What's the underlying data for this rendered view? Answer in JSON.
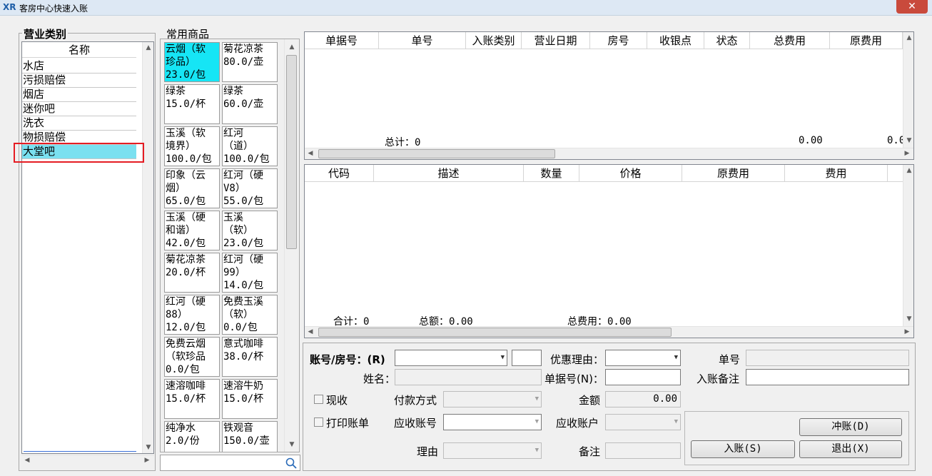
{
  "window": {
    "title": "客房中心快速入账",
    "app_icon": "XR",
    "close_glyph": "✕"
  },
  "category_panel": {
    "title": "营业类别",
    "column_header": "名称",
    "items": [
      "水店",
      "污损赔偿",
      "烟店",
      "迷你吧",
      "洗衣",
      "物损赔偿",
      "大堂吧"
    ],
    "selected_index": 6
  },
  "products_panel": {
    "title": "常用商品",
    "tiles": [
      "云烟（软\n珍品）\n23.0/包",
      "菊花凉茶\n80.0/壶",
      "绿茶\n15.0/杯",
      "绿茶\n60.0/壶",
      "玉溪（软\n境界）\n100.0/包",
      "红河\n（道）\n100.0/包",
      "印象（云\n烟）\n65.0/包",
      "红河（硬\nV8）\n55.0/包",
      "玉溪（硬\n和谐）\n42.0/包",
      "玉溪\n（软）\n23.0/包",
      "菊花凉茶\n20.0/杯",
      "红河（硬\n99）\n14.0/包",
      "红河（硬\n88）\n12.0/包",
      "免费玉溪\n（软）\n0.0/包",
      "免费云烟\n（软珍品\n0.0/包",
      "意式咖啡\n38.0/杯",
      "速溶咖啡\n15.0/杯",
      "速溶牛奶\n15.0/杯",
      "纯净水\n2.0/份",
      "铁观音\n150.0/壶"
    ],
    "active_index": 0,
    "search_placeholder": ""
  },
  "bill_grid": {
    "columns": [
      "单据号",
      "单号",
      "入账类别",
      "营业日期",
      "房号",
      "收银点",
      "状态",
      "总费用",
      "原费用"
    ],
    "rows": [],
    "total_label": "总计：0",
    "total_fee": "0.00",
    "total_orig_fee": "0.0"
  },
  "detail_grid": {
    "columns": [
      "代码",
      "描述",
      "数量",
      "价格",
      "原费用",
      "费用"
    ],
    "rows": [],
    "summary_count": "合计：0",
    "summary_amount": "总额：0.00",
    "summary_fee": "总费用：0.00"
  },
  "form": {
    "account_label": "账号/房号：(R)",
    "account_value": "",
    "account_extra": "",
    "discount_label": "优惠理由：",
    "discount_value": "",
    "order_no_label": "单号",
    "order_no_value": "",
    "name_label": "姓名：",
    "name_value": "",
    "doc_no_label": "单据号(N)：",
    "doc_no_value": "",
    "remark_label": "入账备注",
    "remark_value": "",
    "cash_label": "现收",
    "cash_checked": false,
    "payment_label": "付款方式",
    "payment_value": "",
    "amount_label": "金额",
    "amount_value": "0.00",
    "print_label": "打印账单",
    "print_checked": false,
    "receivable_account_label": "应收账号",
    "receivable_account_value": "",
    "receivable_owner_label": "应收账户",
    "receivable_owner_value": "",
    "reason_label": "理由",
    "reason_value": "",
    "note_label": "备注",
    "note_value": "",
    "reverse_button": "冲账(D)",
    "post_button": "入账(S)",
    "exit_button": "退出(X)"
  }
}
